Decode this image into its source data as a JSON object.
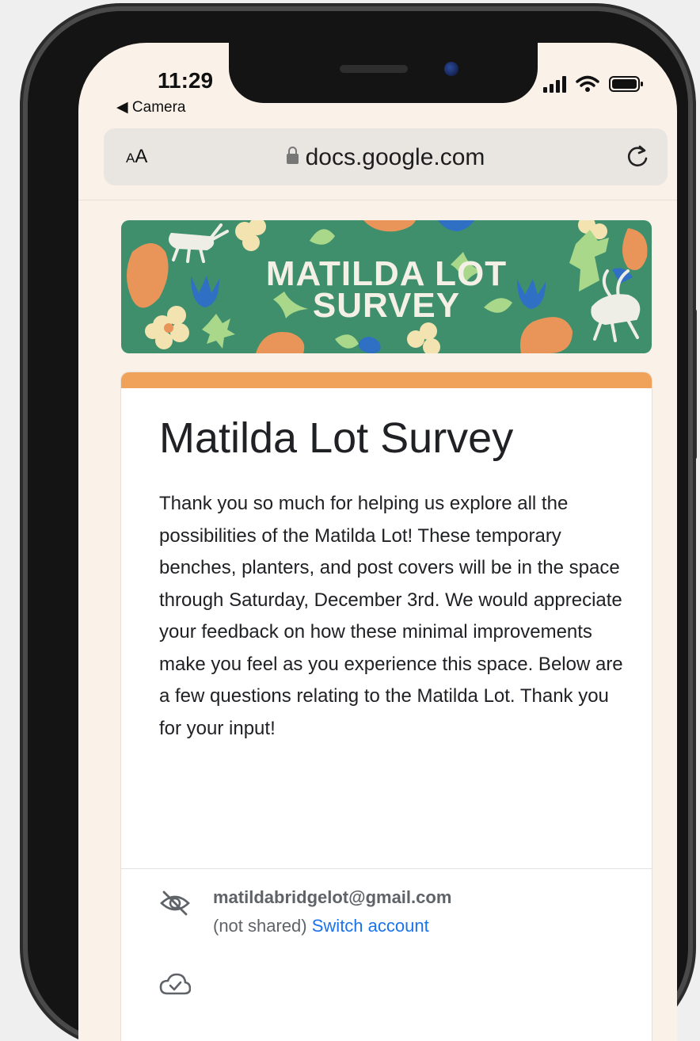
{
  "status_bar": {
    "time": "11:29",
    "back_app": "Camera",
    "icons": [
      "cellular-signal-icon",
      "wifi-icon",
      "battery-icon"
    ]
  },
  "browser": {
    "text_size_label_small": "A",
    "text_size_label_large": "A",
    "url": "docs.google.com",
    "icons": [
      "lock-icon",
      "reload-icon"
    ]
  },
  "banner": {
    "line1": "MATILDA LOT",
    "line2": "SURVEY",
    "colors": {
      "background": "#3f8f6c",
      "orange": "#e9955a",
      "blue": "#2f6fc4",
      "cream": "#f3e3b0",
      "light_green": "#a9d88a"
    }
  },
  "form": {
    "accent_color": "#f0a15a",
    "title": "Matilda Lot Survey",
    "description": "Thank you so much for helping us explore all the possibilities of the Matilda Lot! These temporary benches, planters, and post covers will be in the space through Saturday, December 3rd. We would appreciate your feedback on how these minimal improvements make you feel as you experience this space. Below are a few questions relating to the Matilda Lot. Thank you for your input!",
    "account": {
      "email": "matildabridgelot@gmail.com",
      "not_shared": "(not shared)",
      "switch_label": "Switch account"
    }
  }
}
